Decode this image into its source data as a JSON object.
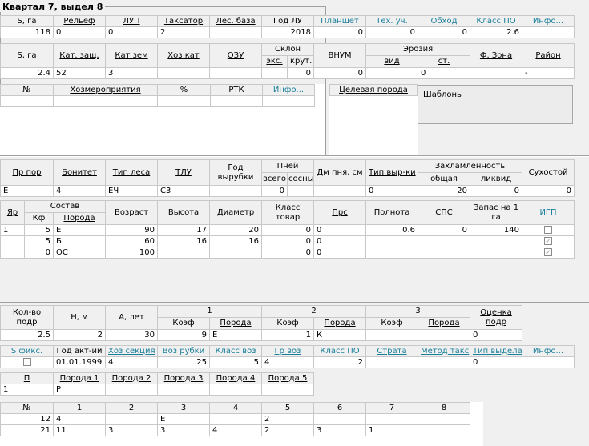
{
  "group_title": "Квартал 7, выдел 8",
  "t1": {
    "headers": [
      "S, га",
      "Рельеф",
      "ЛУП",
      "Таксатор",
      "Лес. база",
      "Год ЛУ",
      "Планшет",
      "Тех. уч.",
      "Обход",
      "Класс ПО",
      "Инфо..."
    ],
    "values": [
      "118",
      "0",
      "0",
      "2",
      "",
      "2018",
      "0",
      "0",
      "0",
      "2.6",
      ""
    ]
  },
  "t2": {
    "headers": [
      "S, га",
      "Кат. защ.",
      "Кат зем",
      "Хоз кат",
      "ОЗУ",
      "Склон",
      "ВНУМ",
      "Эрозия",
      "Ф. Зона",
      "Район"
    ],
    "sub": {
      "exp": "экс.",
      "krut": "крут.",
      "vid": "вид",
      "st": "ст."
    },
    "values": [
      "2.4",
      "52",
      "3",
      "",
      "",
      "",
      "0",
      "0",
      "",
      "0",
      "",
      "-"
    ]
  },
  "t3": {
    "headers": [
      "№",
      "Хозмероприятия",
      "%",
      "РТК",
      "Инфо..."
    ]
  },
  "target_species": "Целевая порода",
  "templates_btn": "Шаблоны",
  "t4": {
    "headers": [
      "Пр пор",
      "Бонитет",
      "Тип леса",
      "ТЛУ",
      "Год вырубки",
      "Пней",
      "Дм пня, см",
      "Тип выр-ки",
      "Захламленность",
      "Сухостой"
    ],
    "sub": {
      "vsego": "всего",
      "sosny": "сосны",
      "total": "общая",
      "liq": "ликвид"
    },
    "values": [
      "Е",
      "4",
      "ЕЧ",
      "С3",
      "",
      "0",
      "",
      "",
      "0",
      "20",
      "0",
      "0"
    ]
  },
  "t5": {
    "headers": [
      "Яр",
      "Состав",
      "Возраст",
      "Высота",
      "Диаметр",
      "Класс товар",
      "Прс",
      "Полнота",
      "СПС",
      "Запас на 1 га",
      "ИГП"
    ],
    "sub": {
      "kf": "Кф",
      "poroda": "Порода"
    },
    "rows": [
      {
        "yar": "1",
        "kf": "5",
        "species": "Е",
        "age": "90",
        "height": "17",
        "diam": "20",
        "cls": "0",
        "prs": "0",
        "poln": "0.6",
        "sps": "0",
        "stock": "140",
        "igp": ""
      },
      {
        "yar": "",
        "kf": "5",
        "species": "Б",
        "age": "60",
        "height": "16",
        "diam": "16",
        "cls": "0",
        "prs": "0",
        "poln": "",
        "sps": "",
        "stock": "",
        "igp": "✓"
      },
      {
        "yar": "",
        "kf": "0",
        "species": "ОС",
        "age": "100",
        "height": "",
        "diam": "",
        "cls": "0",
        "prs": "0",
        "poln": "",
        "sps": "",
        "stock": "",
        "igp": "✓"
      }
    ]
  },
  "t6": {
    "headers": [
      "Кол-во подр",
      "Н, м",
      "А, лет",
      "1",
      "2",
      "3",
      "Оценка подр"
    ],
    "sub": {
      "koef": "Коэф",
      "poroda": "Порода"
    },
    "values": [
      "2.5",
      "2",
      "30",
      "9",
      "Е",
      "1",
      "К",
      "",
      "",
      "0"
    ]
  },
  "t7": {
    "headers": [
      "S фикс.",
      "Год акт-ии",
      "Хоз секция",
      "Воз рубки",
      "Класс воз",
      "Гр воз",
      "Класс ПО",
      "Страта",
      "Метод такс",
      "Тип выдела",
      "Инфо..."
    ],
    "values": [
      "",
      "01.01.1999",
      "4",
      "25",
      "5",
      "4",
      "2",
      "",
      "",
      "0",
      ""
    ]
  },
  "t8": {
    "headers": [
      "П",
      "Порода 1",
      "Порода 2",
      "Порода 3",
      "Порода 4",
      "Порода 5"
    ],
    "values": [
      "1",
      "Р",
      "",
      "",
      "",
      ""
    ]
  },
  "t9": {
    "headers": [
      "№",
      "1",
      "2",
      "3",
      "4",
      "5",
      "6",
      "7",
      "8"
    ],
    "rows": [
      [
        "12",
        "4",
        "",
        "Е",
        "",
        "2",
        "",
        "",
        ""
      ],
      [
        "21",
        "11",
        "3",
        "3",
        "4",
        "2",
        "3",
        "1",
        ""
      ]
    ]
  }
}
